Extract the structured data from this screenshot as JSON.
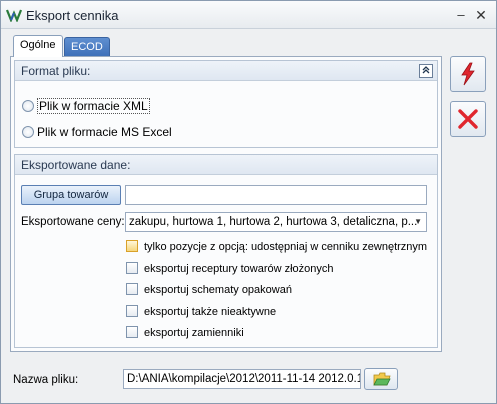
{
  "window": {
    "title": "Eksport cennika",
    "minimize_glyph": "–",
    "close_glyph": "✕"
  },
  "tabs": [
    {
      "label": "Ogólne",
      "active": true
    },
    {
      "label": "ECOD",
      "active": false
    }
  ],
  "format_group": {
    "header": "Format pliku:",
    "collapse_icon": "chevron-double-up-icon",
    "options": [
      {
        "label": "Plik w formacie XML",
        "selected": false,
        "focused": true
      },
      {
        "label": "Plik w formacie MS Excel",
        "selected": false,
        "focused": false
      }
    ]
  },
  "export_group": {
    "header": "Eksportowane dane:",
    "grupa_button": "Grupa towarów",
    "grupa_value": "",
    "ceny_label": "Eksportowane ceny:",
    "ceny_value": "zakupu, hurtowa 1, hurtowa 2, hurtowa 3, detaliczna, p...",
    "checkboxes": [
      {
        "label": "tylko pozycje z opcją: udostępniaj w cenniku zewnętrznym",
        "checked": false,
        "highlighted": true
      },
      {
        "label": "eksportuj receptury towarów złożonych",
        "checked": false,
        "highlighted": false
      },
      {
        "label": "eksportuj schematy opakowań",
        "checked": false,
        "highlighted": false
      },
      {
        "label": "eksportuj także nieaktywne",
        "checked": false,
        "highlighted": false
      },
      {
        "label": "eksportuj zamienniki",
        "checked": false,
        "highlighted": false
      }
    ]
  },
  "side_buttons": [
    {
      "icon": "lightning-icon",
      "color": "#e0262e"
    },
    {
      "icon": "close-x-icon",
      "color": "#e0262e"
    }
  ],
  "file": {
    "label": "Nazwa pliku:",
    "value": "D:\\ANIA\\kompilacje\\2012\\2011-11-14 2012.0.1.",
    "browse_icon": "folder-open-icon"
  },
  "colors": {
    "accent": "#3d6fb8",
    "danger": "#e0262e"
  }
}
